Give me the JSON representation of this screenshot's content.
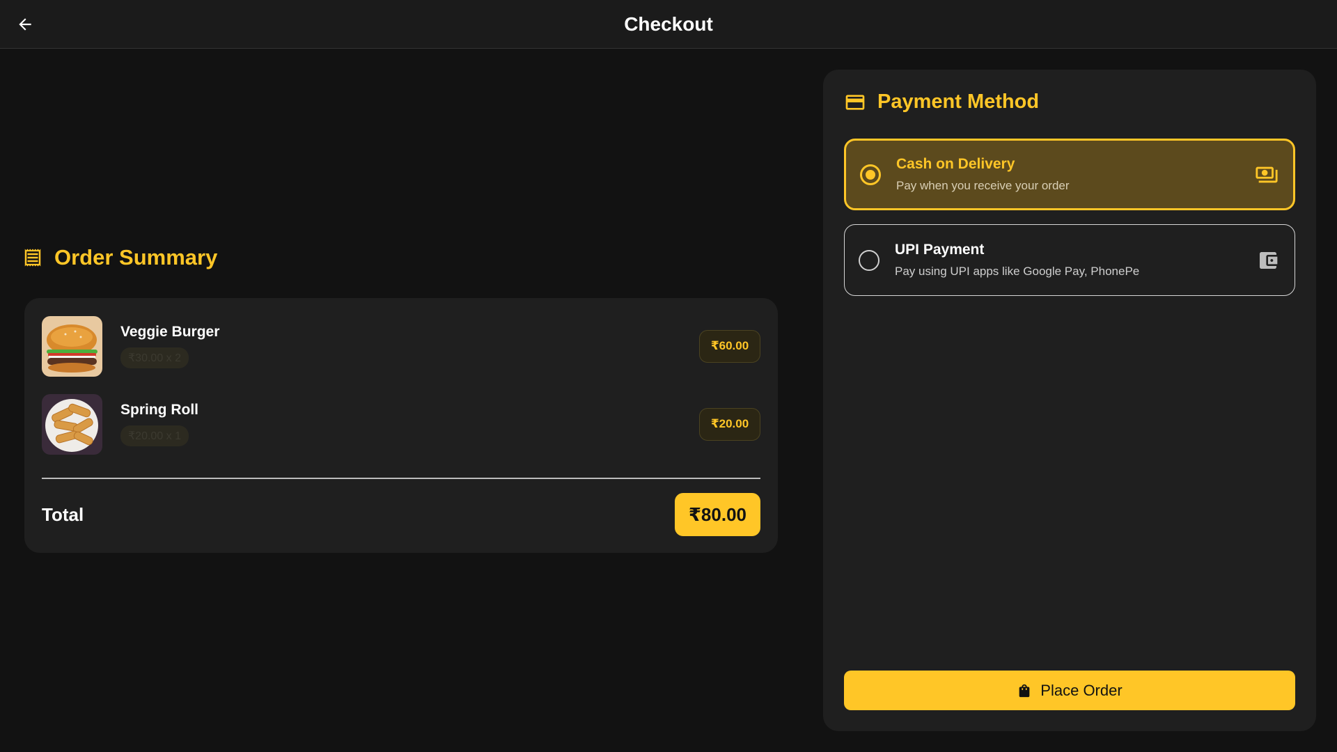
{
  "appbar": {
    "title": "Checkout"
  },
  "order_summary": {
    "title": "Order Summary",
    "items": [
      {
        "name": "Veggie Burger",
        "qty_text": "₹30.00 x 2",
        "price": "₹60.00",
        "image": "burger"
      },
      {
        "name": "Spring Roll",
        "qty_text": "₹20.00 x 1",
        "price": "₹20.00",
        "image": "spring-rolls"
      }
    ],
    "total_label": "Total",
    "total_value": "₹80.00"
  },
  "payment": {
    "title": "Payment Method",
    "options": [
      {
        "title": "Cash on Delivery",
        "subtitle": "Pay when you receive your order",
        "selected": true,
        "icon": "cash-icon"
      },
      {
        "title": "UPI Payment",
        "subtitle": "Pay using UPI apps like Google Pay, PhonePe",
        "selected": false,
        "icon": "wallet-icon"
      }
    ],
    "place_order_label": "Place Order"
  },
  "colors": {
    "accent": "#FFC627",
    "background": "#121212",
    "card": "#1f1f1f"
  }
}
